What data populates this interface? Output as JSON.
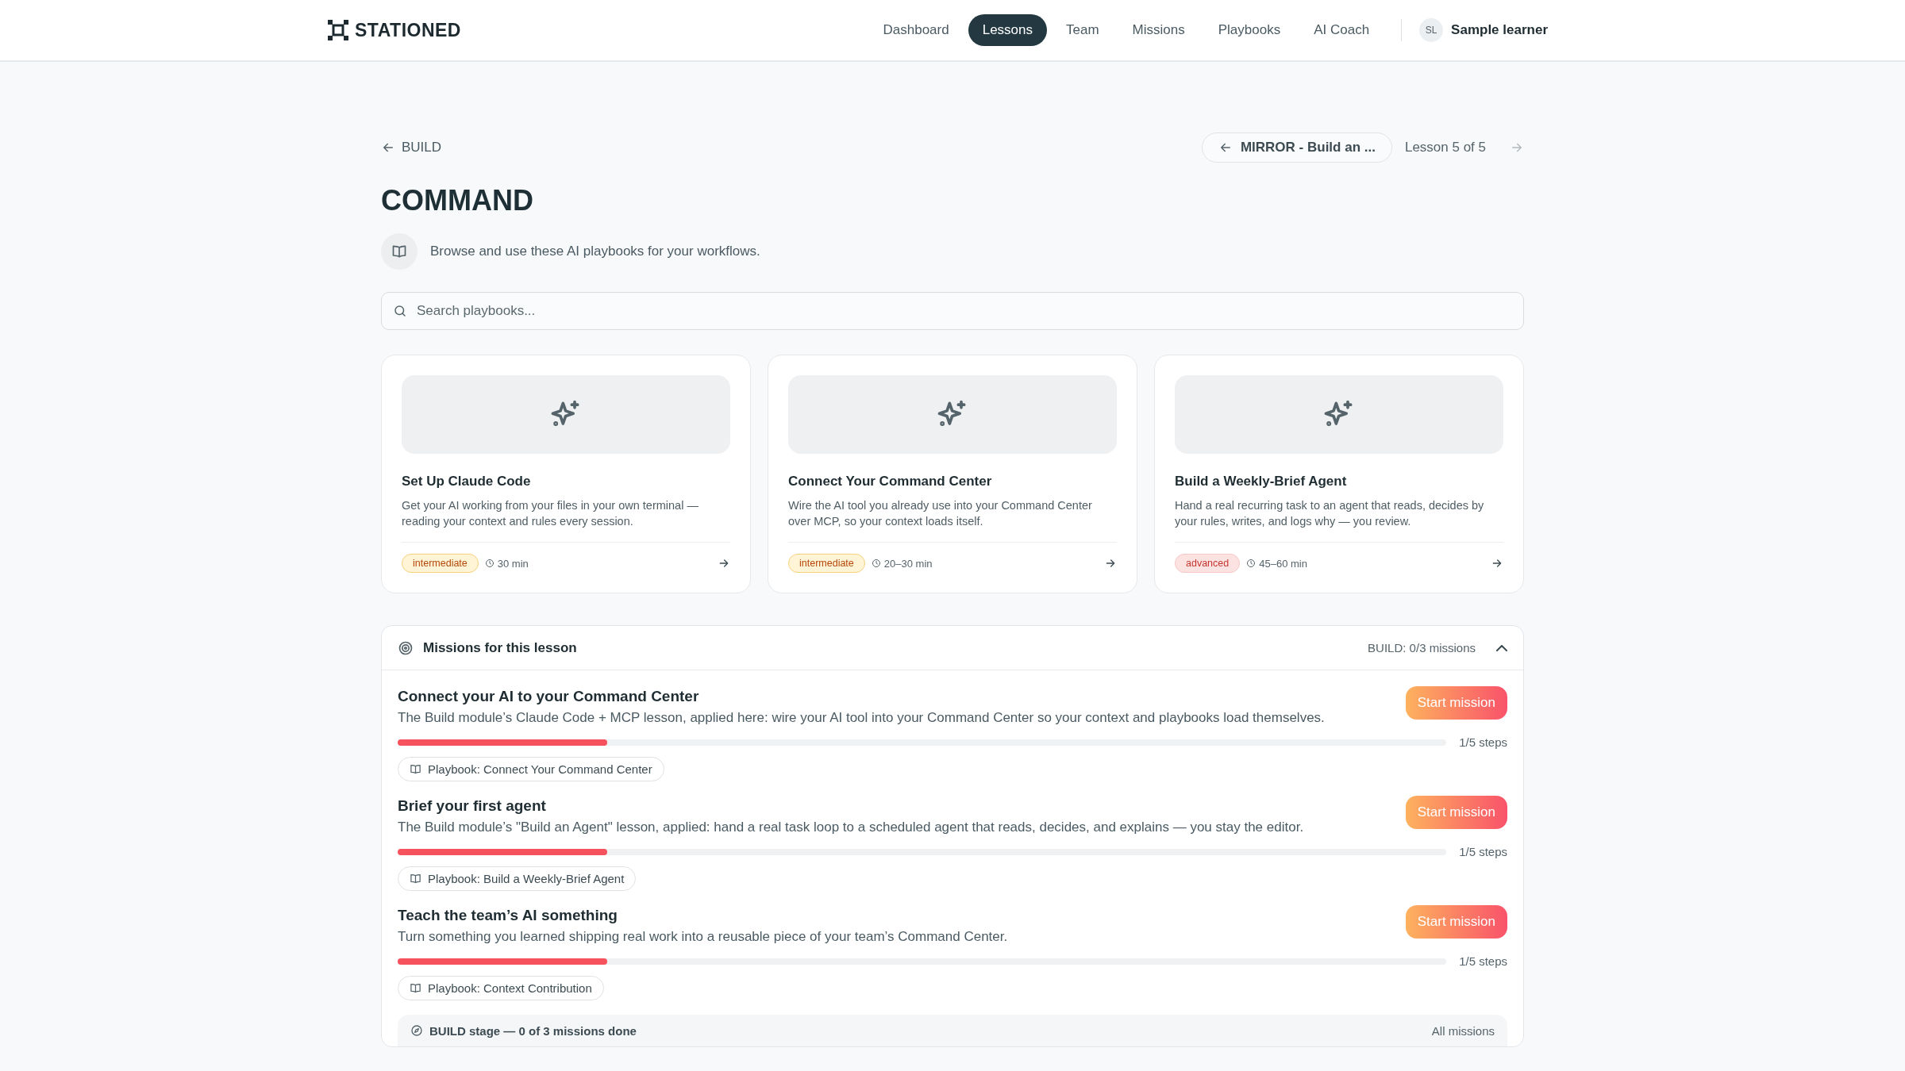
{
  "header": {
    "logo": "STATIONED",
    "nav": [
      {
        "label": "Dashboard",
        "selected": false
      },
      {
        "label": "Lessons",
        "selected": true
      },
      {
        "label": "Team",
        "selected": false
      },
      {
        "label": "Missions",
        "selected": false
      },
      {
        "label": "Playbooks",
        "selected": false
      },
      {
        "label": "AI Coach",
        "selected": false
      }
    ],
    "user": {
      "initials": "SL",
      "name": "Sample learner"
    }
  },
  "breadcrumb": {
    "back": "BUILD",
    "previous": "MIRROR - Build an ...",
    "position": "Lesson 5 of 5"
  },
  "title": "COMMAND",
  "intro": "Browse and use these AI playbooks for your workflows.",
  "search": {
    "placeholder": "Search playbooks..."
  },
  "playbooks": [
    {
      "title": "Set Up Claude Code",
      "description": "Get your AI working from your files in your own terminal — reading your context and rules every session.",
      "difficulty": "intermediate",
      "duration": "30 min"
    },
    {
      "title": "Connect Your Command Center",
      "description": "Wire the AI tool you already use into your Command Center over MCP, so your context loads itself.",
      "difficulty": "intermediate",
      "duration": "20–30 min"
    },
    {
      "title": "Build a Weekly-Brief Agent",
      "description": "Hand a real recurring task to an agent that reads, decides by your rules, writes, and logs why — you review.",
      "difficulty": "advanced",
      "duration": "45–60 min"
    }
  ],
  "missions": {
    "title": "Missions for this lesson",
    "summary": "BUILD: 0/3 missions",
    "expanded": true,
    "items": [
      {
        "title": "Connect your AI to your Command Center",
        "description": "The Build module’s Claude Code + MCP lesson, applied here: wire your AI tool into your Command Center so your context and playbooks load themselves.",
        "button": "Start mission",
        "level": 0.2,
        "steps": "1/5 steps",
        "playbook": "Playbook: Connect Your Command Center"
      },
      {
        "title": "Brief your first agent",
        "description": "The Build module’s \"Build an Agent\" lesson, applied: hand a real task loop to a scheduled agent that reads, decides, and explains — you stay the editor.",
        "button": "Start mission",
        "level": 0.2,
        "steps": "1/5 steps",
        "playbook": "Playbook: Build a Weekly-Brief Agent"
      },
      {
        "title": "Teach the team’s AI something",
        "description": "Turn something you learned shipping real work into a reusable piece of your team’s Command Center.",
        "button": "Start mission",
        "level": 0.2,
        "steps": "1/5 steps",
        "playbook": "Playbook: Context Contribution"
      }
    ],
    "footer": {
      "status": "BUILD stage — 0 of 3 missions done",
      "link": "All missions"
    }
  }
}
